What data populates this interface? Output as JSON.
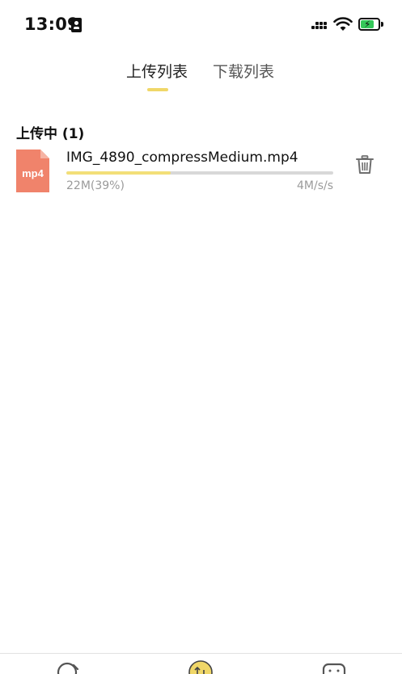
{
  "status_bar": {
    "time": "13:09",
    "icons": [
      "id-badge-icon",
      "cellular-signal-icon",
      "wifi-icon",
      "battery-charging-icon"
    ],
    "battery_color": "#34c759",
    "battery_level": 0.75
  },
  "tabs": [
    {
      "label": "上传列表",
      "active": true
    },
    {
      "label": "下载列表",
      "active": false
    }
  ],
  "accent_color": "#f0d768",
  "upload_section": {
    "title": "上传中 (1)",
    "items": [
      {
        "file_type_label": "mp4",
        "file_icon_color": "#f0836b",
        "file_name": "IMG_4890_compressMedium.mp4",
        "progress_percent": 39,
        "size_text": "22M(39%)",
        "speed_text": "4M/s/s",
        "delete_icon": "trash-icon"
      }
    ]
  },
  "bottom_nav": {
    "icons": [
      "home-tab-icon",
      "transfer-tab-icon",
      "message-tab-icon"
    ]
  }
}
